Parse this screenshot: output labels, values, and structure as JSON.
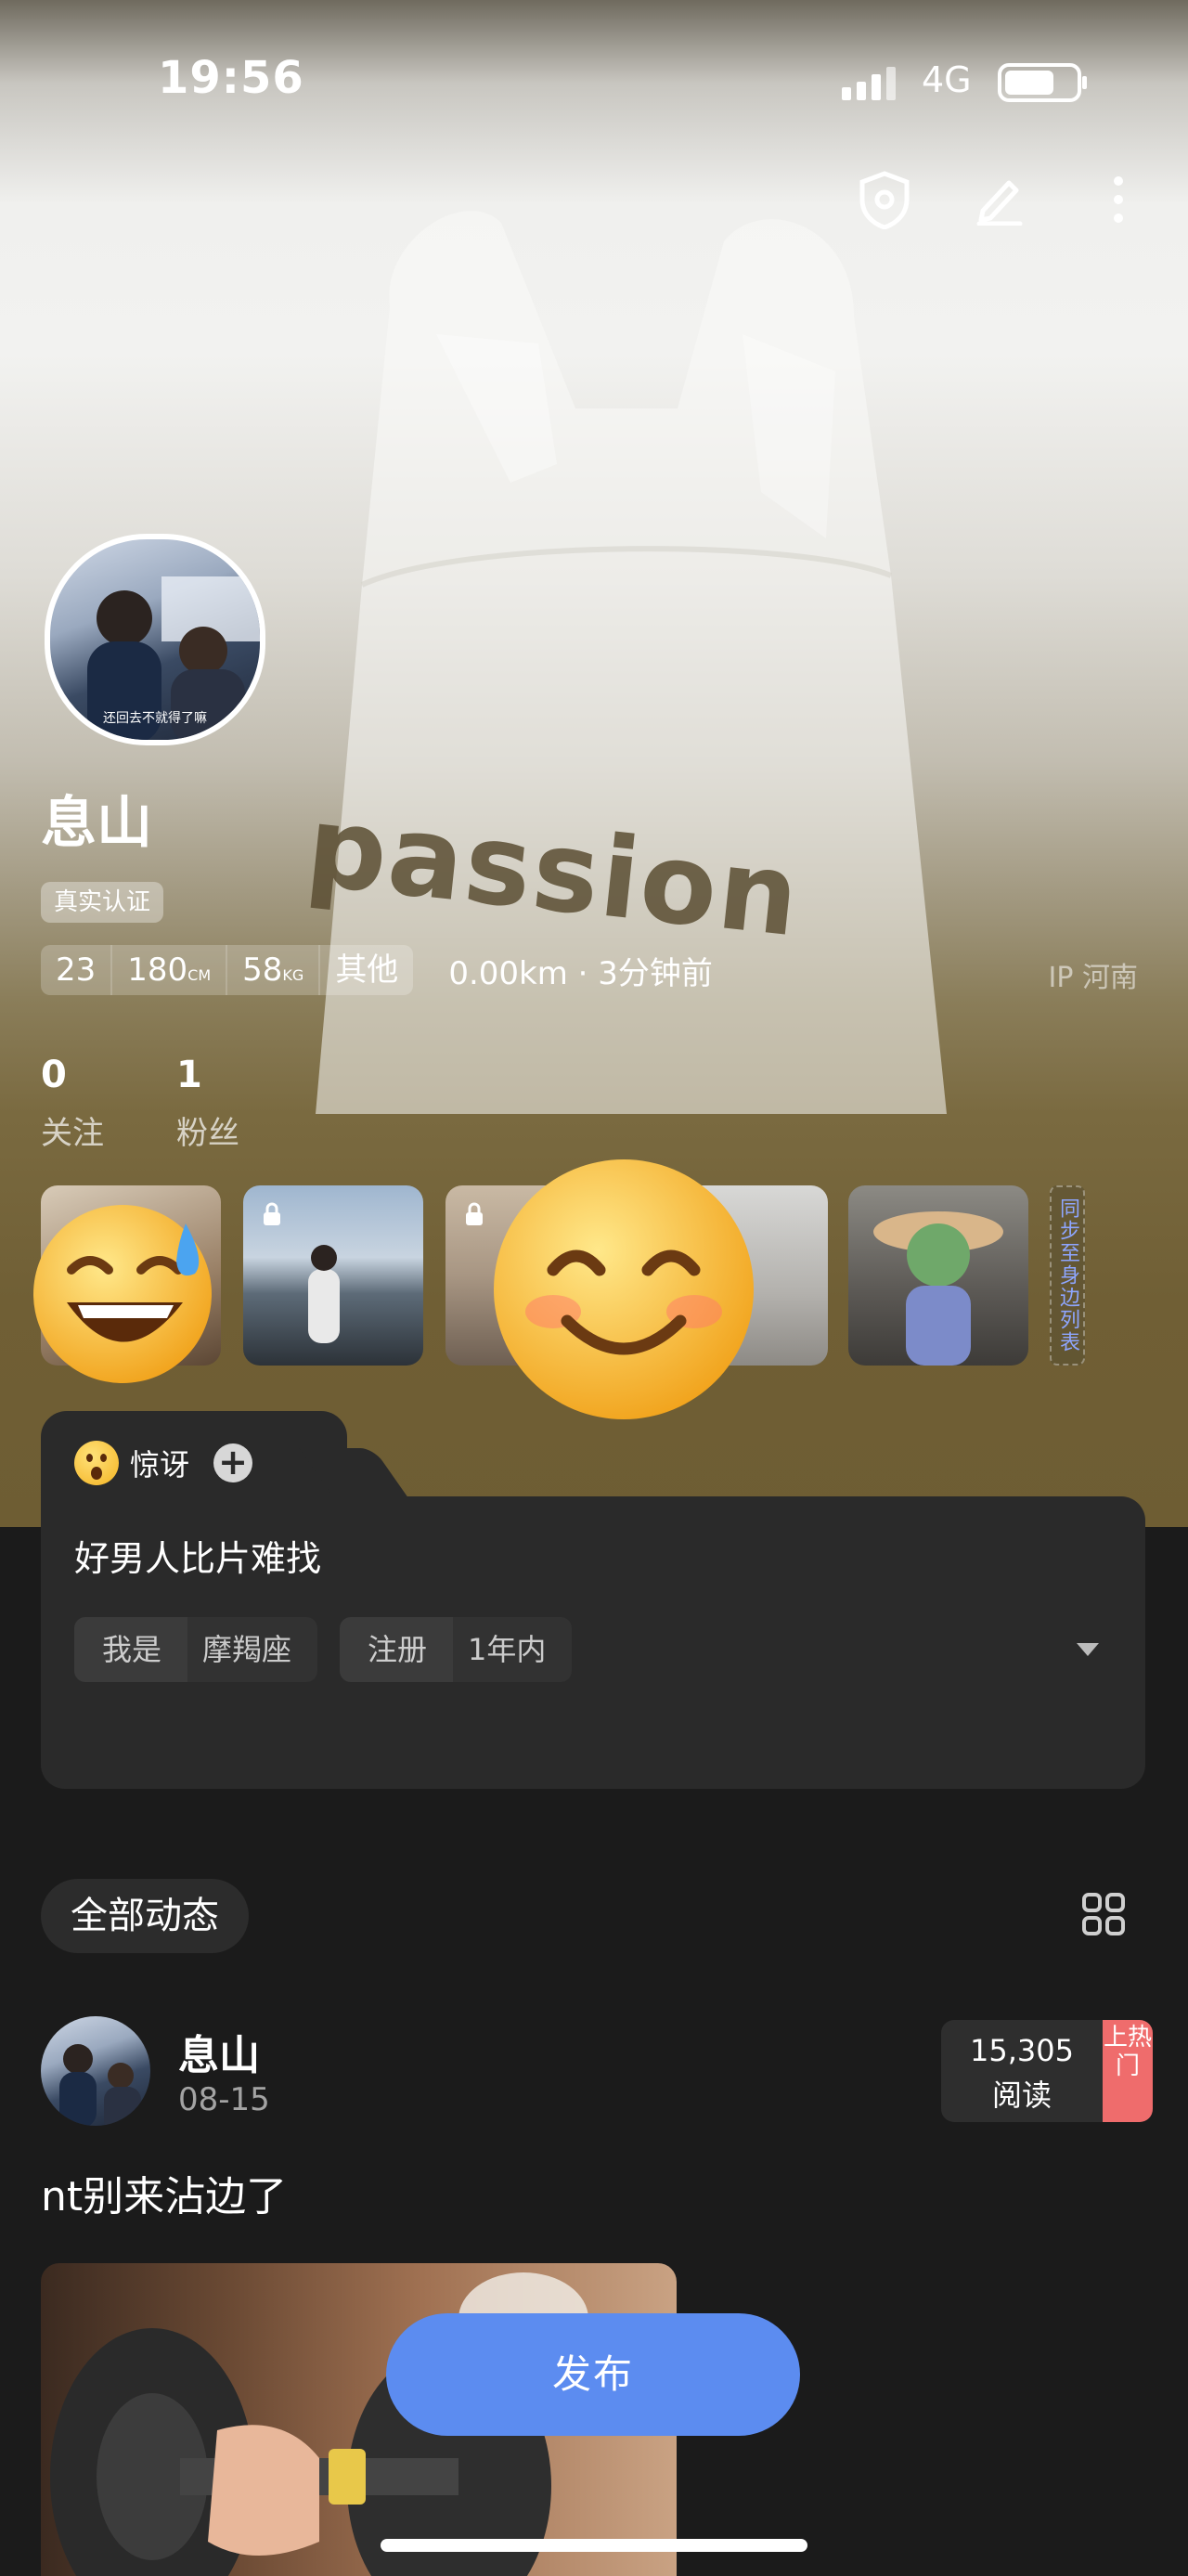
{
  "status_bar": {
    "time": "19:56",
    "network": "4G"
  },
  "profile": {
    "name": "息山",
    "avatar_caption": "还回去不就得了嘛",
    "verified_label": "真实认证",
    "attributes": [
      {
        "value": "23",
        "unit": ""
      },
      {
        "value": "180",
        "unit": "CM"
      },
      {
        "value": "58",
        "unit": "KG"
      },
      {
        "value": "其他",
        "unit": ""
      }
    ],
    "distance": "0.00km · 3分钟前",
    "ip": "IP 河南",
    "following_count": "0",
    "following_label": "关注",
    "followers_count": "1",
    "followers_label": "粉丝",
    "sync_label": "同步至身边列表"
  },
  "cover": {
    "text": "passion"
  },
  "mood_card": {
    "mood": "惊讶",
    "add": "+",
    "bio": "好男人比片难找",
    "tags": [
      {
        "key": "我是",
        "value": "摩羯座"
      },
      {
        "key": "注册",
        "value": "1年内"
      }
    ]
  },
  "feed": {
    "tab": "全部动态",
    "post": {
      "author": "息山",
      "date": "08-15",
      "reads_count": "15,305",
      "reads_label": "阅读",
      "hot_label": "上热门",
      "text": "nt别来沾边了"
    }
  },
  "publish_button": "发布",
  "colors": {
    "accent": "#5c8cf0",
    "hot": "#ef6c6c",
    "background": "#1b1b1b"
  }
}
